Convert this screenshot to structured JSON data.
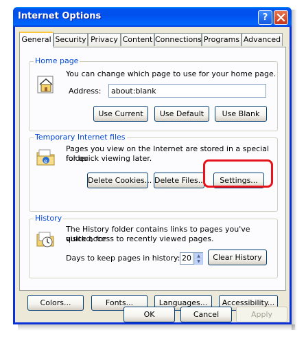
{
  "window": {
    "title": "Internet Options"
  },
  "title_buttons": {
    "help": "?",
    "close": "X"
  },
  "tabs": [
    "General",
    "Security",
    "Privacy",
    "Content",
    "Connections",
    "Programs",
    "Advanced"
  ],
  "active_tab": "General",
  "home_page": {
    "label": "Home page",
    "description": "You can change which page to use for your home page.",
    "address_label": "Address:",
    "address_value": "about:blank",
    "buttons": {
      "use_current": "Use Current",
      "use_default": "Use Default",
      "use_blank": "Use Blank"
    }
  },
  "temp_files": {
    "label": "Temporary Internet files",
    "description_line1": "Pages you view on the Internet are stored in a special folder",
    "description_line2": "for quick viewing later.",
    "buttons": {
      "delete_cookies": "Delete Cookies...",
      "delete_files": "Delete Files...",
      "settings": "Settings..."
    }
  },
  "history": {
    "label": "History",
    "description_line1": "The History folder contains links to pages you've visited, for",
    "description_line2": "quick access to recently viewed pages.",
    "days_label": "Days to keep pages in history:",
    "days_value": "20",
    "clear_button": "Clear History"
  },
  "bottom_buttons": {
    "colors": "Colors...",
    "fonts": "Fonts...",
    "languages": "Languages...",
    "accessibility": "Accessibility..."
  },
  "dialog_buttons": {
    "ok": "OK",
    "cancel": "Cancel",
    "apply": "Apply"
  },
  "colors": {
    "title_bar": "#0054e3",
    "dialog_bg": "#ece9d8",
    "group_label": "#0046d5",
    "highlight": "#e8121a"
  },
  "icons": {
    "home": "house-icon",
    "temp": "folder-ie-icon",
    "history": "history-folder-clock-icon"
  }
}
